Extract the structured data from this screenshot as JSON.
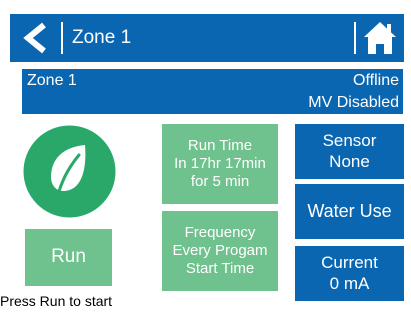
{
  "header": {
    "title": "Zone 1"
  },
  "status": {
    "zone": "Zone 1",
    "connection": "Offline",
    "mv": "MV Disabled"
  },
  "buttons": {
    "run": "Run",
    "run_time": [
      "Run Time",
      "In 17hr 17min",
      "for 5 min"
    ],
    "frequency": [
      "Frequency",
      "Every Progam",
      "Start Time"
    ],
    "sensor": [
      "Sensor",
      "None"
    ],
    "water_use": "Water Use",
    "current": [
      "Current",
      "0 mA"
    ]
  },
  "footer": {
    "hint": "Press Run to start"
  },
  "colors": {
    "blue": "#0b66b1",
    "green": "#6fc18d",
    "leaf_circle": "#2aa86a"
  },
  "icons": [
    "back-arrow-icon",
    "home-icon",
    "leaf-icon"
  ]
}
